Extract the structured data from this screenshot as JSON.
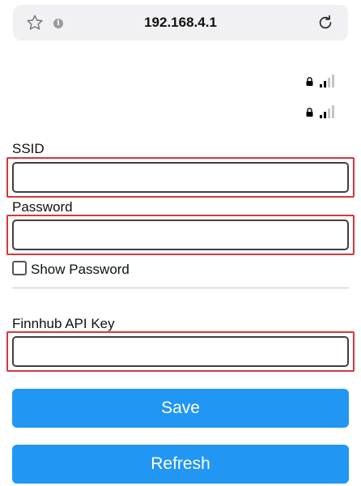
{
  "browser": {
    "url": "192.168.4.1",
    "icons": [
      "star-icon",
      "info-icon",
      "reload-icon"
    ]
  },
  "networks": [
    {
      "icons": [
        "lock-icon",
        "signal-icon"
      ]
    },
    {
      "icons": [
        "lock-icon",
        "signal-icon"
      ]
    }
  ],
  "form": {
    "ssid_label": "SSID",
    "ssid_value": "",
    "password_label": "Password",
    "password_value": "",
    "show_password_label": "Show Password",
    "api_key_label": "Finnhub API Key",
    "api_key_value": ""
  },
  "buttons": {
    "save": "Save",
    "refresh": "Refresh"
  },
  "colors": {
    "button_bg": "#2196f3",
    "highlight": "#d6363c",
    "urlbar_bg": "#f1f1f3"
  }
}
